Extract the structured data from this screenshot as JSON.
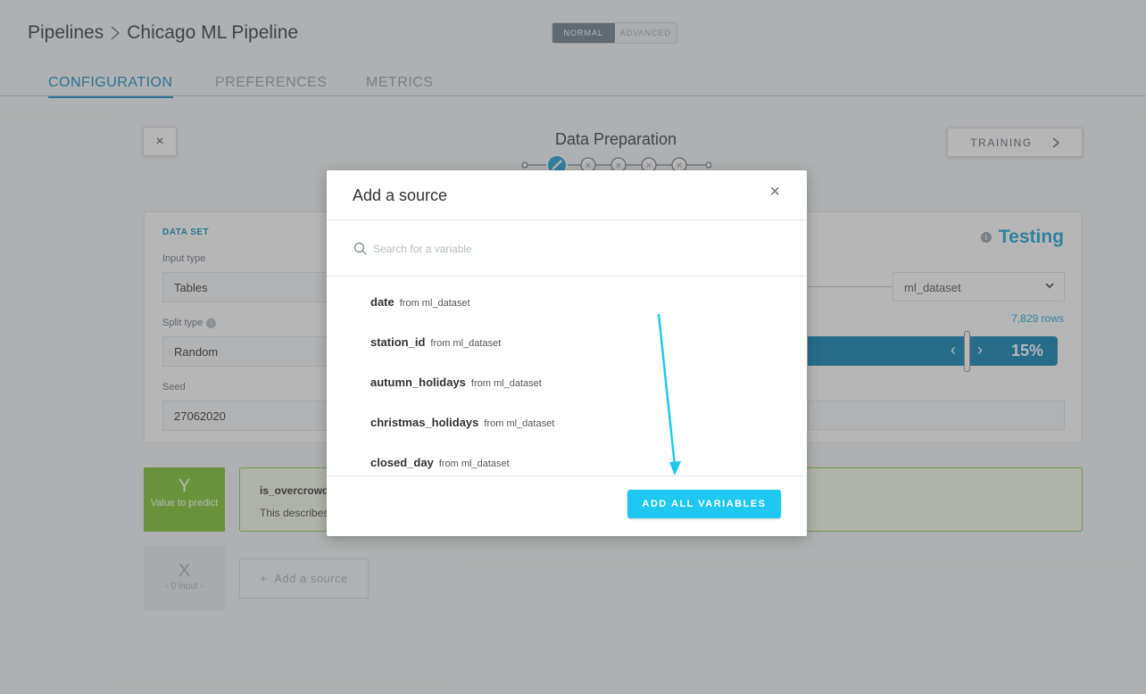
{
  "header": {
    "breadcrumb_root": "Pipelines",
    "breadcrumb_current": "Chicago ML Pipeline",
    "mode_normal": "NORMAL",
    "mode_advanced": "ADVANCED"
  },
  "tabs": [
    {
      "label": "CONFIGURATION",
      "active": true
    },
    {
      "label": "PREFERENCES",
      "active": false
    },
    {
      "label": "METRICS",
      "active": false
    }
  ],
  "stepper": {
    "title": "Data Preparation",
    "next_label": "TRAINING",
    "close_label": "×"
  },
  "dataset": {
    "section_title": "DATA SET",
    "input_type_label": "Input type",
    "input_type_value": "Tables",
    "split_type_label": "Split type",
    "split_type_value": "Random",
    "seed_label": "Seed",
    "seed_value": "27062020",
    "testing_title": "Testing",
    "testing_dataset": "ml_dataset",
    "rows_count": "7,829 rows",
    "testing_percent": "15%"
  },
  "target": {
    "y_letter": "Y",
    "y_caption": "Value to predict",
    "variable": "is_overcrowded",
    "description": "This describes"
  },
  "inputs": {
    "x_letter": "X",
    "x_caption": "- 0 input -",
    "add_source_label": "Add a source"
  },
  "modal": {
    "title": "Add a source",
    "close": "×",
    "search_placeholder": "Search for a variable",
    "variables": [
      {
        "name": "date",
        "source": "from ml_dataset"
      },
      {
        "name": "station_id",
        "source": "from ml_dataset"
      },
      {
        "name": "autumn_holidays",
        "source": "from ml_dataset"
      },
      {
        "name": "christmas_holidays",
        "source": "from ml_dataset"
      },
      {
        "name": "closed_day",
        "source": "from ml_dataset"
      }
    ],
    "add_all_label": "ADD ALL VARIABLES"
  },
  "colors": {
    "accent": "#128cbf",
    "primary_button": "#1ec8f1",
    "target_green": "#7cc22e",
    "slider_blue": "#0a80b6",
    "annotation_arrow": "#1ec8f1"
  }
}
